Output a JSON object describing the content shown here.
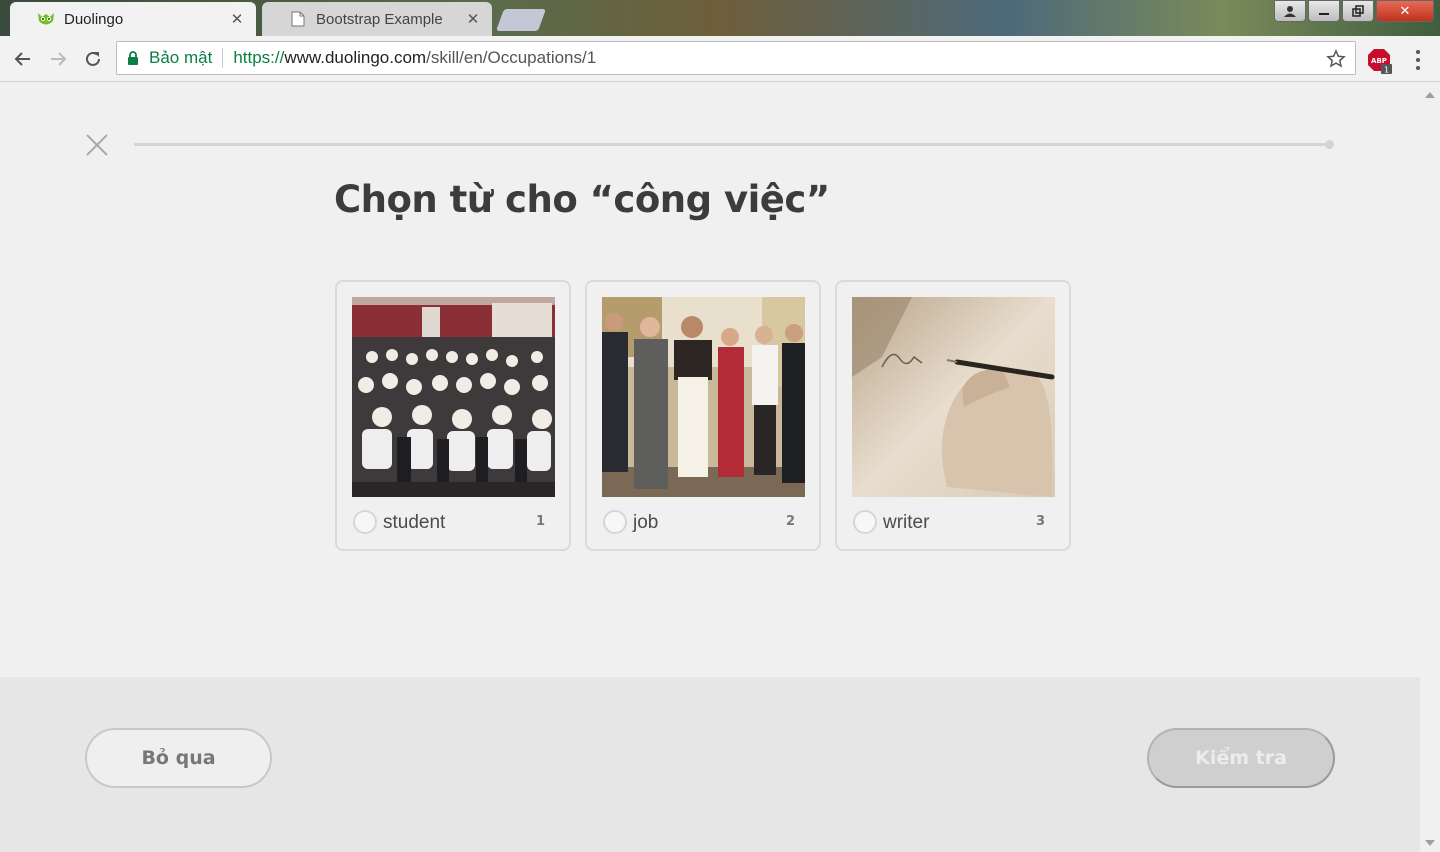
{
  "browser": {
    "tabs": [
      {
        "title": "Duolingo",
        "icon": "duolingo-owl-icon",
        "active": true
      },
      {
        "title": "Bootstrap Example",
        "icon": "page-icon",
        "active": false
      }
    ],
    "omnibox": {
      "security_label": "Bảo mật",
      "url_scheme": "https://",
      "url_host": "www.duolingo.com",
      "url_path": "/skill/en/Occupations/1"
    },
    "extension": {
      "name": "adblock-plus-icon",
      "badge": "1"
    }
  },
  "lesson": {
    "prompt": "Chọn từ cho “công việc”",
    "progress_fraction": 0.0,
    "choices": [
      {
        "word": "student",
        "key": "1",
        "image": "classroom-students-photo"
      },
      {
        "word": "job",
        "key": "2",
        "image": "group-people-photo"
      },
      {
        "word": "writer",
        "key": "3",
        "image": "hand-writing-photo"
      }
    ]
  },
  "footer": {
    "skip_label": "Bỏ qua",
    "check_label": "Kiểm tra"
  },
  "colors": {
    "page_bg": "#f0f0f0",
    "footer_bg": "#e6e6e6",
    "secure_green": "#0b8043",
    "disabled_button": "#cfcfcf"
  }
}
